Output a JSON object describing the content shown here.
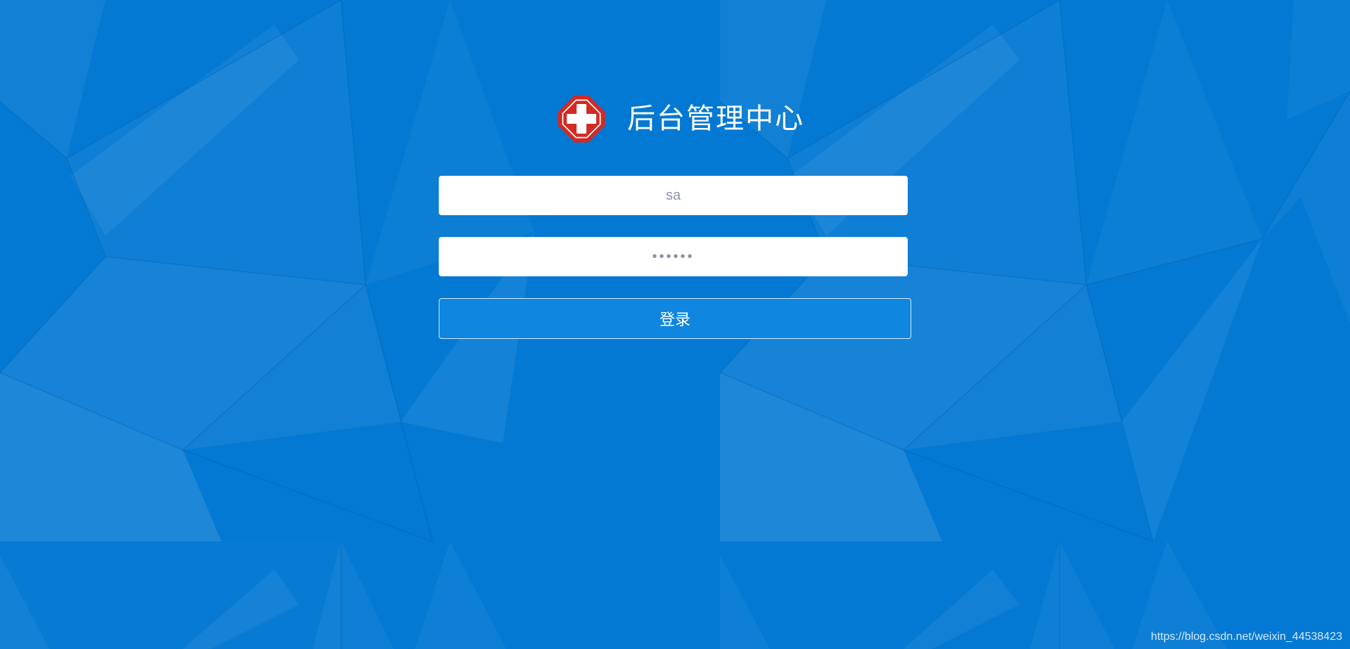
{
  "app": {
    "title": "后台管理中心",
    "logo_icon": "red-cross-icon"
  },
  "login_form": {
    "username": {
      "value": "sa",
      "placeholder": ""
    },
    "password": {
      "value": "123456",
      "placeholder": ""
    },
    "submit_label": "登录"
  },
  "watermark": "https://blog.csdn.net/weixin_44538423",
  "colors": {
    "background": "#0379d3",
    "button": "#0f86e0",
    "logo_red": "#d12b24",
    "text": "#ffffff"
  }
}
